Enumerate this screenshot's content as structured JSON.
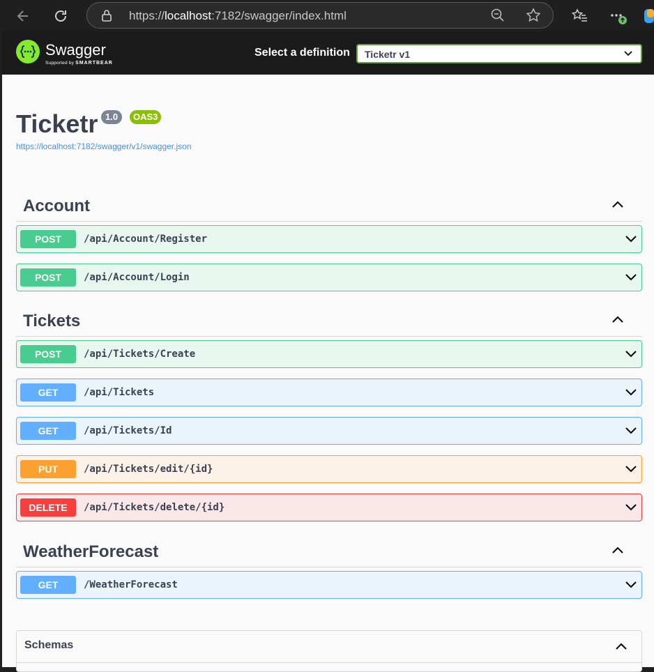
{
  "browser": {
    "url_prefix": "https://",
    "url_host": "localhost",
    "url_rest": ":7182/swagger/index.html"
  },
  "topbar": {
    "brand": "Swagger",
    "brand_sub_prefix": "Supported by",
    "brand_sub_company": "SMARTBEAR",
    "definition_label": "Select a definition",
    "definition_value": "Ticketr v1"
  },
  "info": {
    "title": "Ticketr",
    "version": "1.0",
    "oas": "OAS3",
    "spec_url": "https://localhost:7182/swagger/v1/swagger.json"
  },
  "tags": [
    {
      "name": "Account",
      "operations": [
        {
          "method": "POST",
          "path": "/api/Account/Register"
        },
        {
          "method": "POST",
          "path": "/api/Account/Login"
        }
      ]
    },
    {
      "name": "Tickets",
      "operations": [
        {
          "method": "POST",
          "path": "/api/Tickets/Create"
        },
        {
          "method": "GET",
          "path": "/api/Tickets"
        },
        {
          "method": "GET",
          "path": "/api/Tickets/Id"
        },
        {
          "method": "PUT",
          "path": "/api/Tickets/edit/{id}"
        },
        {
          "method": "DELETE",
          "path": "/api/Tickets/delete/{id}"
        }
      ]
    },
    {
      "name": "WeatherForecast",
      "operations": [
        {
          "method": "GET",
          "path": "/WeatherForecast"
        }
      ]
    }
  ],
  "schemas": {
    "label": "Schemas"
  },
  "colors": {
    "post": "#49cc90",
    "get": "#61affe",
    "put": "#fca130",
    "delete": "#f93e3e",
    "swagger_green": "#85ea2d",
    "oas_badge": "#89bf04"
  }
}
